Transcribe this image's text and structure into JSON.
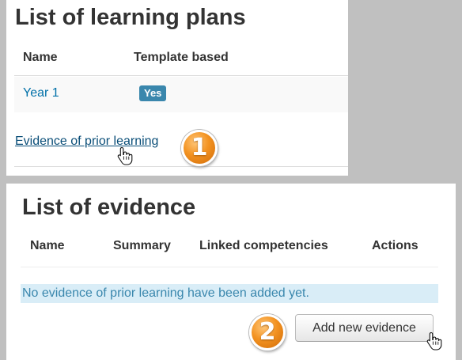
{
  "learning_plans": {
    "title": "List of learning plans",
    "columns": [
      "Name",
      "Template based"
    ],
    "rows": [
      {
        "name": "Year 1",
        "template_based": "Yes"
      }
    ],
    "evidence_link": "Evidence of prior learning"
  },
  "evidence": {
    "title": "List of evidence",
    "columns": [
      "Name",
      "Summary",
      "Linked competencies",
      "Actions"
    ],
    "empty_message": "No evidence of prior learning have been added yet.",
    "add_button": "Add new evidence"
  },
  "callouts": {
    "step1": "1",
    "step2": "2"
  },
  "icons": {
    "cursor": "hand-pointer-icon"
  },
  "colors": {
    "link": "#0070a8",
    "badge": "#3a87ad",
    "info_bg": "#d9edf7",
    "info_text": "#3a87ad",
    "callout": "#f39322"
  }
}
